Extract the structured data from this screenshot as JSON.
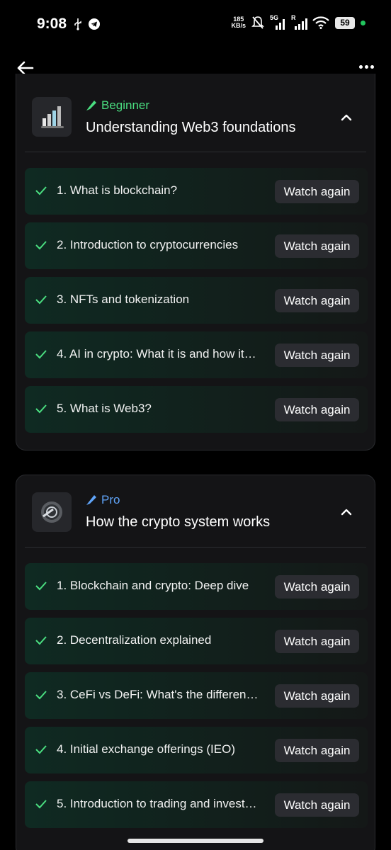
{
  "status_bar": {
    "time": "9:08",
    "net_speed_value": "185",
    "net_speed_unit": "KB/s",
    "network": "5G",
    "roaming": "R",
    "battery": "59",
    "icons": [
      "usb-icon",
      "telegram-icon",
      "mute-icon",
      "signal-icon",
      "wifi-icon"
    ]
  },
  "colors": {
    "beginner": "#4ade80",
    "pro": "#60a5fa",
    "check": "#4ade80",
    "button_bg": "#2b2c31"
  },
  "courses": [
    {
      "level": "Beginner",
      "title": "Understanding Web3 foundations",
      "lessons": [
        {
          "title": "1. What is blockchain?",
          "action": "Watch again"
        },
        {
          "title": "2. Introduction to cryptocurrencies",
          "action": "Watch again"
        },
        {
          "title": "3. NFTs and tokenization",
          "action": "Watch again"
        },
        {
          "title": "4. AI in crypto: What it is and how it…",
          "action": "Watch again"
        },
        {
          "title": "5. What is Web3?",
          "action": "Watch again"
        }
      ]
    },
    {
      "level": "Pro",
      "title": "How the crypto system works",
      "lessons": [
        {
          "title": "1. Blockchain and crypto: Deep dive",
          "action": "Watch again"
        },
        {
          "title": "2. Decentralization explained",
          "action": "Watch again"
        },
        {
          "title": "3. CeFi vs DeFi: What's the differen…",
          "action": "Watch again"
        },
        {
          "title": "4. Initial exchange offerings (IEO)",
          "action": "Watch again"
        },
        {
          "title": "5. Introduction to trading and invest…",
          "action": "Watch again"
        }
      ]
    }
  ]
}
